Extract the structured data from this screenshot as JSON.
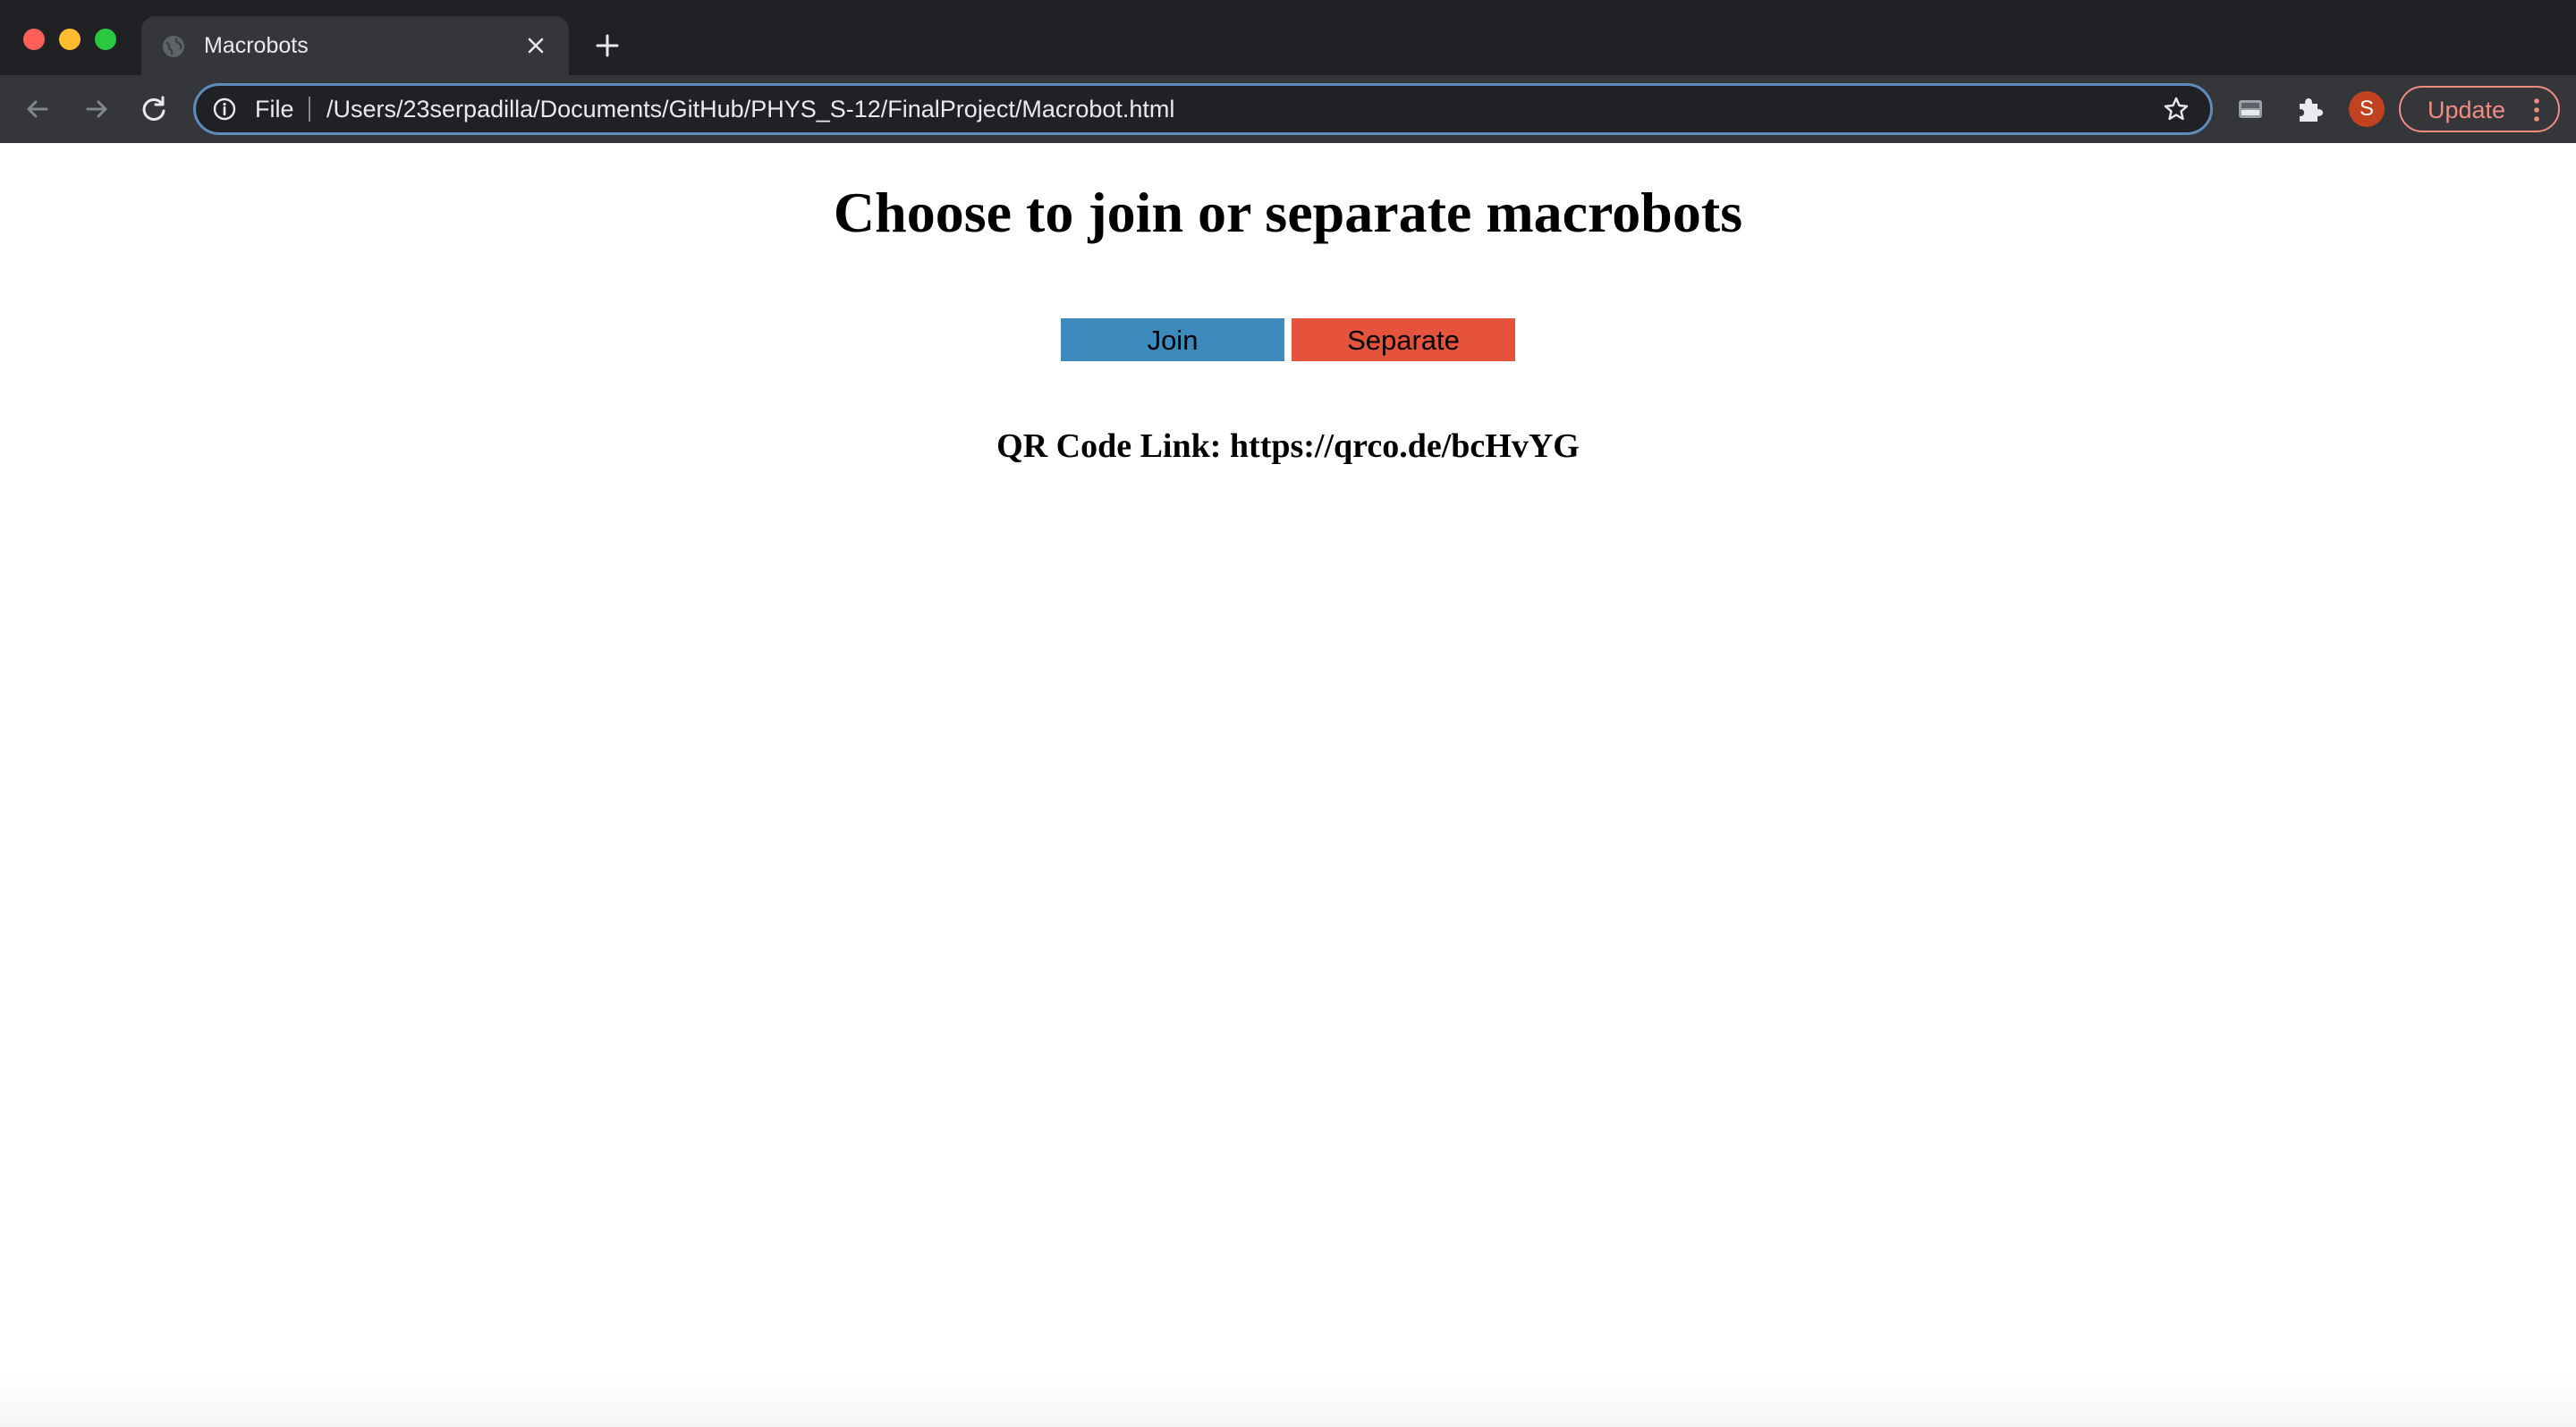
{
  "window": {
    "controls": [
      "close",
      "minimize",
      "zoom"
    ]
  },
  "tab": {
    "title": "Macrobots",
    "favicon": "globe-icon",
    "close_icon": "close-icon",
    "new_tab_icon": "plus-icon"
  },
  "toolbar": {
    "back_icon": "back-arrow-icon",
    "forward_icon": "forward-arrow-icon",
    "reload_icon": "reload-icon",
    "omnibox": {
      "info_icon": "info-icon",
      "scheme_label": "File",
      "url": "/Users/23serpadilla/Documents/GitHub/PHYS_S-12/FinalProject/Macrobot.html",
      "bookmark_icon": "star-icon"
    },
    "cast_icon": "cast-icon",
    "extensions_icon": "puzzle-icon",
    "profile_initial": "S",
    "update_label": "Update",
    "menu_icon": "kebab-menu-icon"
  },
  "page": {
    "title": "Choose to join or separate macrobots",
    "buttons": {
      "join_label": "Join",
      "separate_label": "Separate"
    },
    "qr_text": "QR Code Link: https://qrco.de/bcHvYG"
  },
  "colors": {
    "chrome_dark": "#202124",
    "toolbar": "#35363a",
    "omnibox_focus": "#5f8bbd",
    "join_button": "#3d8bbd",
    "separate_button": "#e5533d",
    "avatar": "#c2411f",
    "update_accent": "#f28b82"
  }
}
